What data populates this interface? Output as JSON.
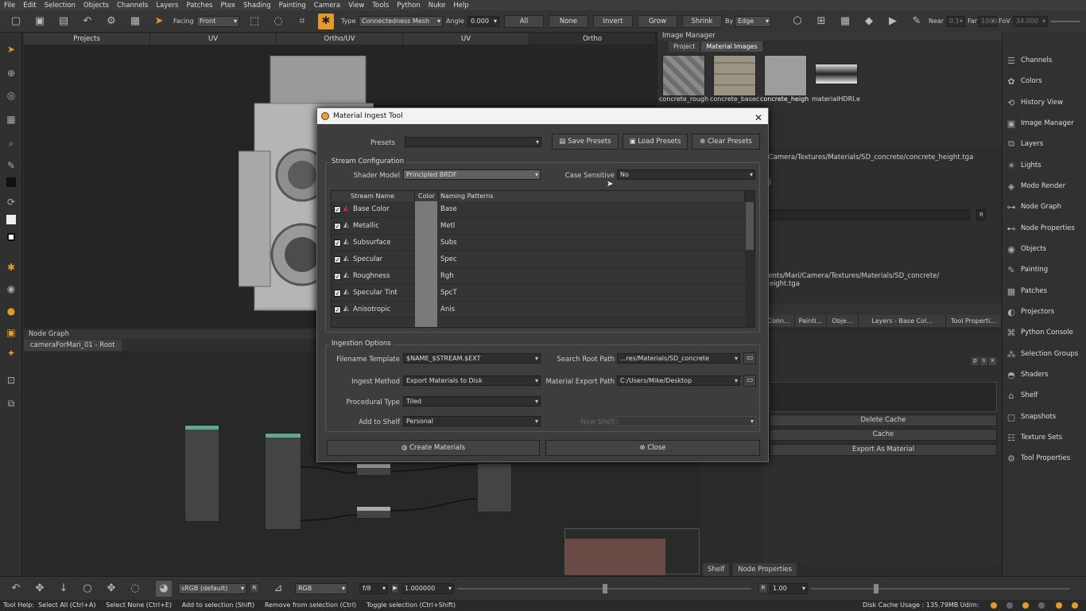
{
  "menu": [
    "File",
    "Edit",
    "Selection",
    "Objects",
    "Channels",
    "Layers",
    "Patches",
    "Ptex",
    "Shading",
    "Painting",
    "Camera",
    "View",
    "Tools",
    "Python",
    "Nuke",
    "Help"
  ],
  "toolbar": {
    "facing_label": "Facing",
    "facing_value": "Front",
    "type_label": "Type",
    "type_value": "Connectedness Mesh",
    "angle_label": "Angle",
    "angle_value": "0.000",
    "buttons": [
      "All",
      "None",
      "Invert",
      "Grow",
      "Shrink"
    ],
    "by_label": "By",
    "by_value": "Edge",
    "near_label": "Near",
    "near_value": "0.1",
    "far_label": "Far",
    "far_value": "1000",
    "fov_label": "FoV",
    "fov_value": "34.000"
  },
  "viewport_tabs": [
    "Projects",
    "UV",
    "Ortho/UV",
    "UV",
    "Ortho"
  ],
  "node_graph": {
    "title": "Node Graph",
    "breadcrumb": "cameraForMari_01 - Root"
  },
  "image_manager": {
    "title": "Image Manager",
    "tabs": [
      "Project",
      "Material Images"
    ],
    "images": [
      "concrete_rough",
      "concrete_basec",
      "concrete_heigh",
      "materialHDRI.e"
    ]
  },
  "mid_panel": {
    "path1": "ri/Camera/Textures/Materials/SD_concrete/concrete_height.tga",
    "field2": "te)",
    "path2a": "ments/Mari/Camera/Textures/Materials/SD_concrete/",
    "path2b": "_height.tga",
    "tabs": [
      "Conn...",
      "Painti...",
      "Obje...",
      "Layers - Base Col...",
      "Tool Properti..."
    ]
  },
  "properties": {
    "small_buttons": [
      "p",
      "s",
      "x"
    ],
    "buttons": [
      "Delete Cache",
      "Cache",
      "Export As Material"
    ],
    "bottom_tabs": [
      "Shelf",
      "Node Properties"
    ]
  },
  "right_shelf": [
    "Channels",
    "Colors",
    "History View",
    "Image Manager",
    "Layers",
    "Lights",
    "Modo Render",
    "Node Graph",
    "Node Properties",
    "Objects",
    "Painting",
    "Patches",
    "Projectors",
    "Python Console",
    "Selection Groups",
    "Shaders",
    "Shelf",
    "Snapshots",
    "Texture Sets",
    "Tool Properties"
  ],
  "bottom_bar": {
    "colorspace": "sRGB (default)",
    "channel": "RGB",
    "fstop": "f/8",
    "exposure": "1.000000",
    "gain_label": "R",
    "gain": "1.00"
  },
  "status": {
    "help": "Tool Help:  Select All (Ctrl+A)     Select None (Ctrl+E)     Add to selection (Shift)     Remove from selection (Ctrl)     Toggle selection (Ctrl+Shift)",
    "disk_cache": "Disk Cache Usage : 135.79MB  Udim:"
  },
  "dialog": {
    "title": "Material Ingest Tool",
    "presets_label": "Presets",
    "presets_value": "",
    "save_presets": "Save Presets",
    "load_presets": "Load Presets",
    "clear_presets": "Clear Presets",
    "stream_config_title": "Stream Configuration",
    "shader_model_label": "Shader Model",
    "shader_model_value": "Principled BRDF",
    "case_sensitive_label": "Case Sensitive",
    "case_sensitive_value": "No",
    "columns": [
      "Stream Name",
      "Color",
      "Naming Patterns"
    ],
    "streams": [
      {
        "name": "Base Color",
        "pattern": "Base"
      },
      {
        "name": "Metallic",
        "pattern": "Metl"
      },
      {
        "name": "Subsurface",
        "pattern": "Subs"
      },
      {
        "name": "Specular",
        "pattern": "Spec"
      },
      {
        "name": "Roughness",
        "pattern": "Rgh"
      },
      {
        "name": "Specular Tint",
        "pattern": "SpcT"
      },
      {
        "name": "Anisotropic",
        "pattern": "Anis"
      }
    ],
    "ingestion_title": "Ingestion Options",
    "filename_template_label": "Filename Template",
    "filename_template_value": "$NAME_$STREAM.$EXT",
    "search_root_label": "Search Root Path",
    "search_root_value": "...res/Materials/SD_concrete",
    "ingest_method_label": "Ingest Method",
    "ingest_method_value": "Export Materials to Disk",
    "export_path_label": "Material Export Path",
    "export_path_value": "C:/Users/Mike/Desktop",
    "procedural_type_label": "Procedural Type",
    "procedural_type_value": "Tiled",
    "add_to_shelf_label": "Add to Shelf",
    "add_to_shelf_value": "Personal",
    "new_shelf_label": "New Shelf",
    "create_materials": "Create Materials",
    "close": "Close"
  },
  "colors": {
    "accent": "#e39a2a",
    "node_header": "#5fa88a",
    "dialog_bg": "#3d3d3d"
  }
}
